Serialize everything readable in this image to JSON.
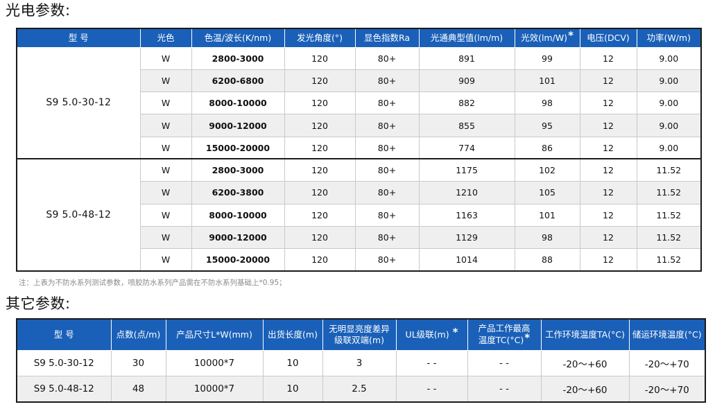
{
  "sections": {
    "optical_title": "光电参数:",
    "other_title": "其它参数:"
  },
  "optical_table": {
    "headers": [
      "型 号",
      "光色",
      "色温/波长(K/nm)",
      "发光角度(°)",
      "显色指数Ra",
      "光通典型值(lm/m)",
      "光效(lm/W)",
      "电压(DCV)",
      "功率(W/m)"
    ],
    "star_mark": "*",
    "groups": [
      {
        "model": "S9 5.0-30-12",
        "rows": [
          [
            "W",
            "2800-3000",
            "120",
            "80+",
            "891",
            "99",
            "12",
            "9.00"
          ],
          [
            "W",
            "6200-6800",
            "120",
            "80+",
            "909",
            "101",
            "12",
            "9.00"
          ],
          [
            "W",
            "8000-10000",
            "120",
            "80+",
            "882",
            "98",
            "12",
            "9.00"
          ],
          [
            "W",
            "9000-12000",
            "120",
            "80+",
            "855",
            "95",
            "12",
            "9.00"
          ],
          [
            "W",
            "15000-20000",
            "120",
            "80+",
            "774",
            "86",
            "12",
            "9.00"
          ]
        ]
      },
      {
        "model": "S9 5.0-48-12",
        "rows": [
          [
            "W",
            "2800-3000",
            "120",
            "80+",
            "1175",
            "102",
            "12",
            "11.52"
          ],
          [
            "W",
            "6200-3800",
            "120",
            "80+",
            "1210",
            "105",
            "12",
            "11.52"
          ],
          [
            "W",
            "8000-10000",
            "120",
            "80+",
            "1163",
            "101",
            "12",
            "11.52"
          ],
          [
            "W",
            "9000-12000",
            "120",
            "80+",
            "1129",
            "98",
            "12",
            "11.52"
          ],
          [
            "W",
            "15000-20000",
            "120",
            "80+",
            "1014",
            "88",
            "12",
            "11.52"
          ]
        ]
      }
    ]
  },
  "note": "注：上表为不防水系列测试参数，喷胶防水系列产品需在不防水系列基础上*0.95；",
  "other_table": {
    "headers": [
      "型 号",
      "点数(点/m)",
      "产品尺寸L*W(mm)",
      "出货长度(m)",
      "无明显亮度差异级联双端(m)",
      "UL级联(m)",
      "产品工作最高温度TC(°C)",
      "工作环境温度TA(°C)",
      "储运环境温度(°C)"
    ],
    "header_multiline": {
      "h4_line1": "无明显亮度差异",
      "h4_line2": "级联双端(m)",
      "h6_line1": "产品工作最高",
      "h6_line2": "温度TC(°C)"
    },
    "star_mark": "*",
    "rows": [
      [
        "S9 5.0-30-12",
        "30",
        "10000*7",
        "10",
        "3",
        "- -",
        "- -",
        "-20～+60",
        "-20～+70"
      ],
      [
        "S9 5.0-48-12",
        "48",
        "10000*7",
        "10",
        "2.5",
        "- -",
        "- -",
        "-20～+60",
        "-20～+70"
      ]
    ]
  }
}
